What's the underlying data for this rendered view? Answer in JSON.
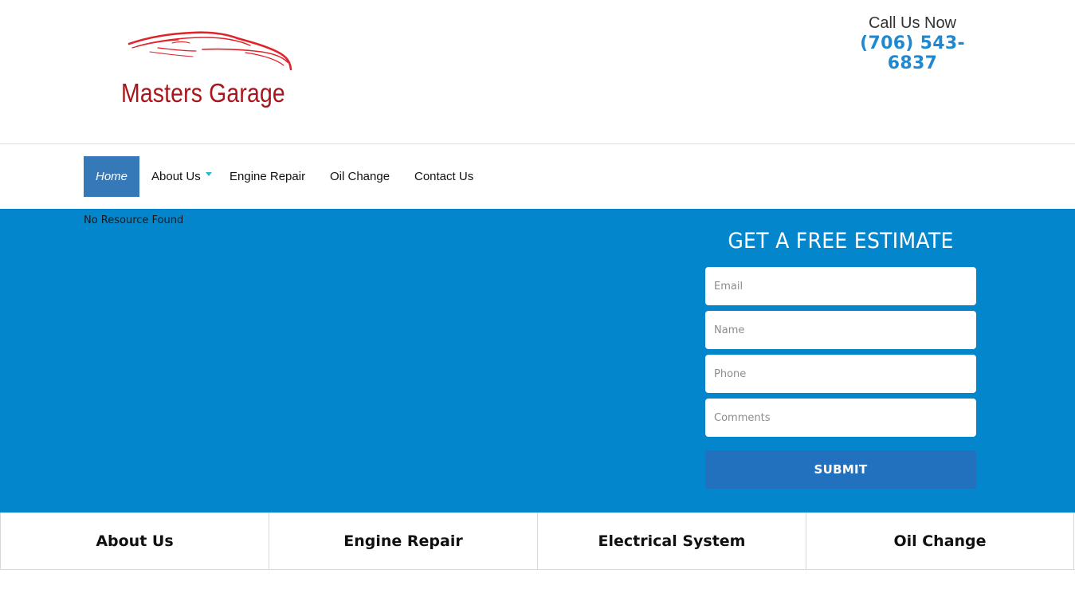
{
  "brand": {
    "name": "Masters Garage",
    "logo_color": "#a8161d",
    "car_stroke_color": "#e0232b"
  },
  "contact": {
    "label": "Call Us Now",
    "phone": "(706) 543-6837",
    "phone_color": "#1e88d0"
  },
  "nav": {
    "items": [
      {
        "label": "Home",
        "active": true
      },
      {
        "label": "About Us",
        "has_dropdown": true
      },
      {
        "label": "Engine Repair"
      },
      {
        "label": "Oil Change"
      },
      {
        "label": "Contact Us"
      }
    ],
    "active_color": "#3679b9"
  },
  "hero": {
    "background": "#0386cb",
    "message": "No Resource Found"
  },
  "estimate_form": {
    "title": "GET A FREE ESTIMATE",
    "fields": [
      {
        "placeholder": "Email",
        "value": ""
      },
      {
        "placeholder": "Name",
        "value": ""
      },
      {
        "placeholder": "Phone",
        "value": ""
      },
      {
        "placeholder": "Comments",
        "value": ""
      }
    ],
    "submit_label": "SUBMIT",
    "submit_color": "#2271bf"
  },
  "services": {
    "items": [
      {
        "label": "About Us"
      },
      {
        "label": "Engine Repair"
      },
      {
        "label": "Electrical System"
      },
      {
        "label": "Oil Change"
      }
    ]
  }
}
